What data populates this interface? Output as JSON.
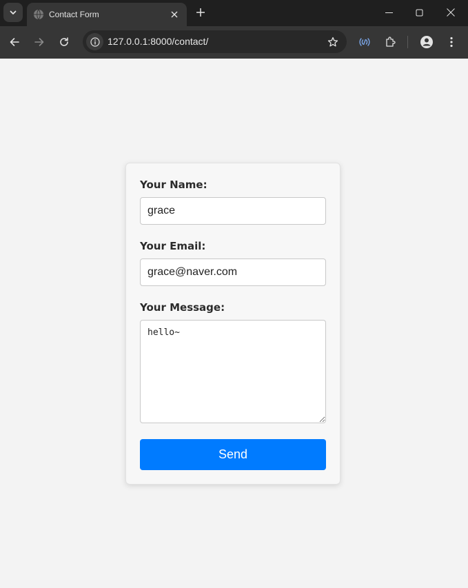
{
  "browser": {
    "tab_title": "Contact Form",
    "url": "127.0.0.1:8000/contact/"
  },
  "form": {
    "name_label": "Your Name:",
    "name_value": "grace",
    "email_label": "Your Email:",
    "email_value": "grace@naver.com",
    "message_label": "Your Message:",
    "message_value": "hello~",
    "send_label": "Send"
  },
  "colors": {
    "accent": "#007bff",
    "page_background": "#f3f3f3",
    "chrome_dark": "#1f1f1f"
  },
  "icons": [
    "tab-search-icon",
    "globe-icon",
    "close-icon",
    "plus-icon",
    "minimize-icon",
    "maximize-icon",
    "back-arrow-icon",
    "forward-arrow-icon",
    "reload-icon",
    "info-icon",
    "star-icon",
    "media-cast-icon",
    "extensions-icon",
    "profile-icon",
    "more-vert-icon"
  ]
}
